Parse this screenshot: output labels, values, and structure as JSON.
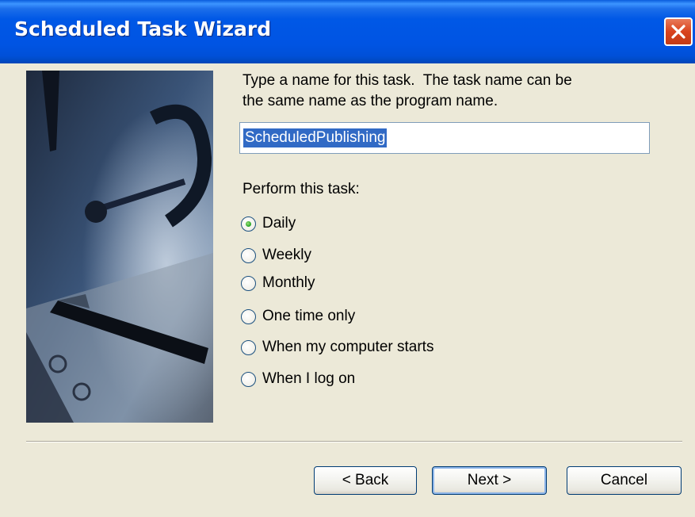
{
  "window": {
    "title": "Scheduled Task Wizard"
  },
  "prompt": {
    "line1": "Type a name for this task.  The task name can be",
    "line2": "the same name as the program name."
  },
  "task_name": {
    "value": "ScheduledPublishing"
  },
  "perform_label": "Perform this task:",
  "options": [
    {
      "label": "Daily",
      "checked": true
    },
    {
      "label": "Weekly",
      "checked": false
    },
    {
      "label": "Monthly",
      "checked": false
    },
    {
      "label": "One time only",
      "checked": false
    },
    {
      "label": "When my computer starts",
      "checked": false
    },
    {
      "label": "When I log on",
      "checked": false
    }
  ],
  "buttons": {
    "back": "< Back",
    "next": "Next >",
    "cancel": "Cancel"
  },
  "icons": {
    "close": "close-icon",
    "side_image": "clock-and-pen-image"
  }
}
